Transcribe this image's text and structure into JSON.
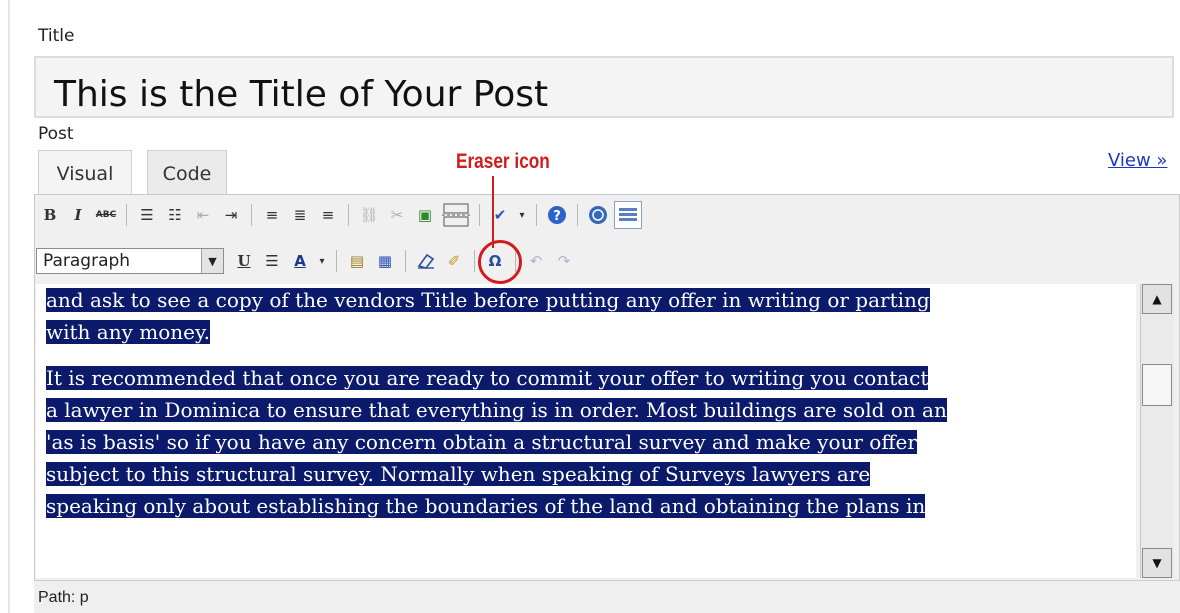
{
  "title_label": "Title",
  "title_value": "This is the Title of Your Post",
  "post_label": "Post",
  "tabs": [
    {
      "label": "Visual",
      "active": true
    },
    {
      "label": "Code",
      "active": false
    }
  ],
  "view_link": "View »",
  "annotation": {
    "text": "Eraser icon",
    "color": "#d21c1c"
  },
  "toolbar1": {
    "bold": "B",
    "italic": "I",
    "strike": "ABC",
    "icons": [
      "bulleted-list-icon",
      "numbered-list-icon",
      "outdent-icon",
      "indent-icon",
      "align-left-icon",
      "align-center-icon",
      "align-right-icon",
      "link-icon",
      "unlink-icon",
      "image-icon",
      "more-icon",
      "spellcheck-icon",
      "help-icon",
      "wordpress-icon",
      "kitchen-sink-icon"
    ]
  },
  "toolbar2": {
    "format_select": "Paragraph",
    "underline": "U",
    "icons": [
      "justify-icon",
      "text-color-icon",
      "paste-text-icon",
      "paste-word-icon",
      "eraser-icon",
      "cleanup-icon",
      "special-char-icon",
      "undo-icon",
      "redo-icon"
    ]
  },
  "content": {
    "paragraphs": [
      [
        "and ask to see a copy of the vendors Title before putting any offer in writing or parting",
        "with any money."
      ],
      [
        "It is recommended that once you are ready to commit your offer to writing you contact",
        "a lawyer in Dominica to ensure that everything is in order. Most buildings are sold on an",
        "'as is basis' so if you have any concern obtain a structural survey and make your offer",
        "subject to this structural survey. Normally when speaking of Surveys lawyers are",
        "speaking only about establishing the boundaries of the land and obtaining the plans in"
      ]
    ],
    "selection_color": "#0c1a6b"
  },
  "status_path": "Path: p"
}
